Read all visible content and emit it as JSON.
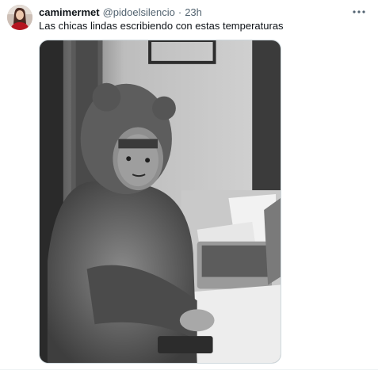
{
  "tweet": {
    "display_name": "camimermet",
    "handle": "@pidoelsilencio",
    "separator": "·",
    "time": "23h",
    "text": "Las chicas lindas escribiendo con estas temperaturas",
    "more_icon": "more-horizontal-icon",
    "media_description_icon": "photo"
  }
}
